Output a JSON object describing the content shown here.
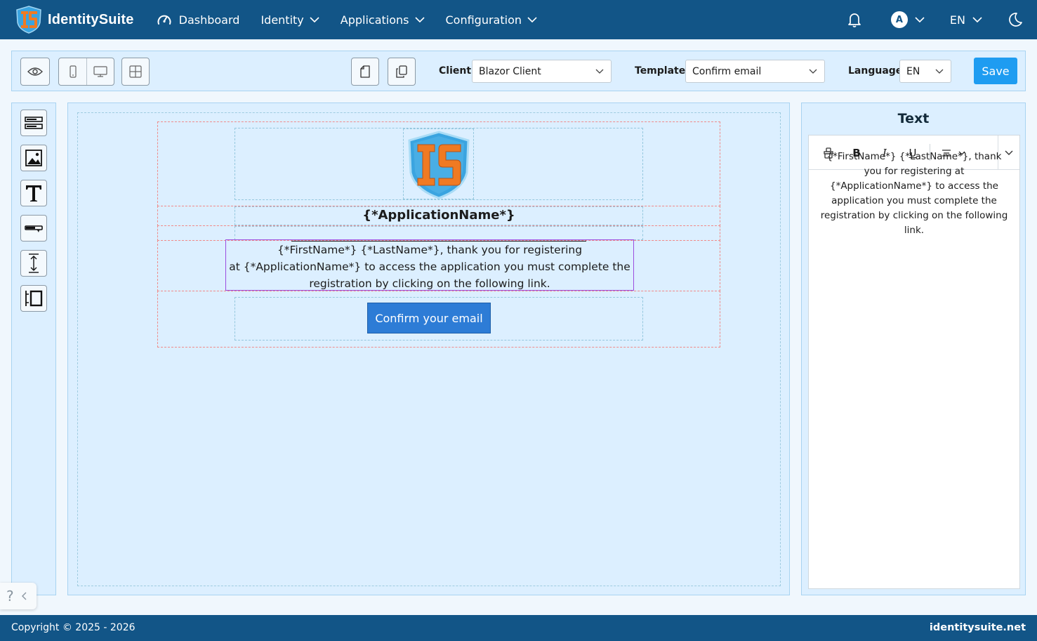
{
  "app": {
    "brand_name": "IdentitySuite",
    "logo_letters": "IS"
  },
  "nav": {
    "dashboard": "Dashboard",
    "identity": "Identity",
    "applications": "Applications",
    "configuration": "Configuration"
  },
  "user": {
    "avatar_initial": "A",
    "language": "EN"
  },
  "toolbar": {
    "client_label": "Client",
    "client_value": "Blazor Client",
    "template_label": "Template",
    "template_value": "Confirm email",
    "language_label": "Language",
    "language_value": "EN",
    "save_label": "Save"
  },
  "canvas": {
    "app_name": "{*ApplicationName*}",
    "body_line1": "{*FirstName*} {*LastName*}, thank you for registering",
    "body_line2": "at {*ApplicationName*} to access the application you must complete the",
    "body_line3": "registration by clicking on the following link.",
    "confirm_button": "Confirm your email"
  },
  "properties": {
    "title": "Text",
    "bold": "B",
    "italic": "I",
    "underline": "U",
    "content": "{*FirstName*} {*LastName*}, thank you for registering at {*ApplicationName*} to access the application you must complete the registration by clicking on the following link."
  },
  "help": {
    "icon": "?"
  },
  "footer": {
    "copyright": "Copyright © 2025 - 2026",
    "site": "identitysuite.net"
  },
  "colors": {
    "primary": "#125587",
    "panel": "#dcefff",
    "save": "#1e9cf1",
    "confirm_button": "#2d7cd6",
    "logo_orange": "#f07a22",
    "logo_blue": "#3aa4e0"
  }
}
